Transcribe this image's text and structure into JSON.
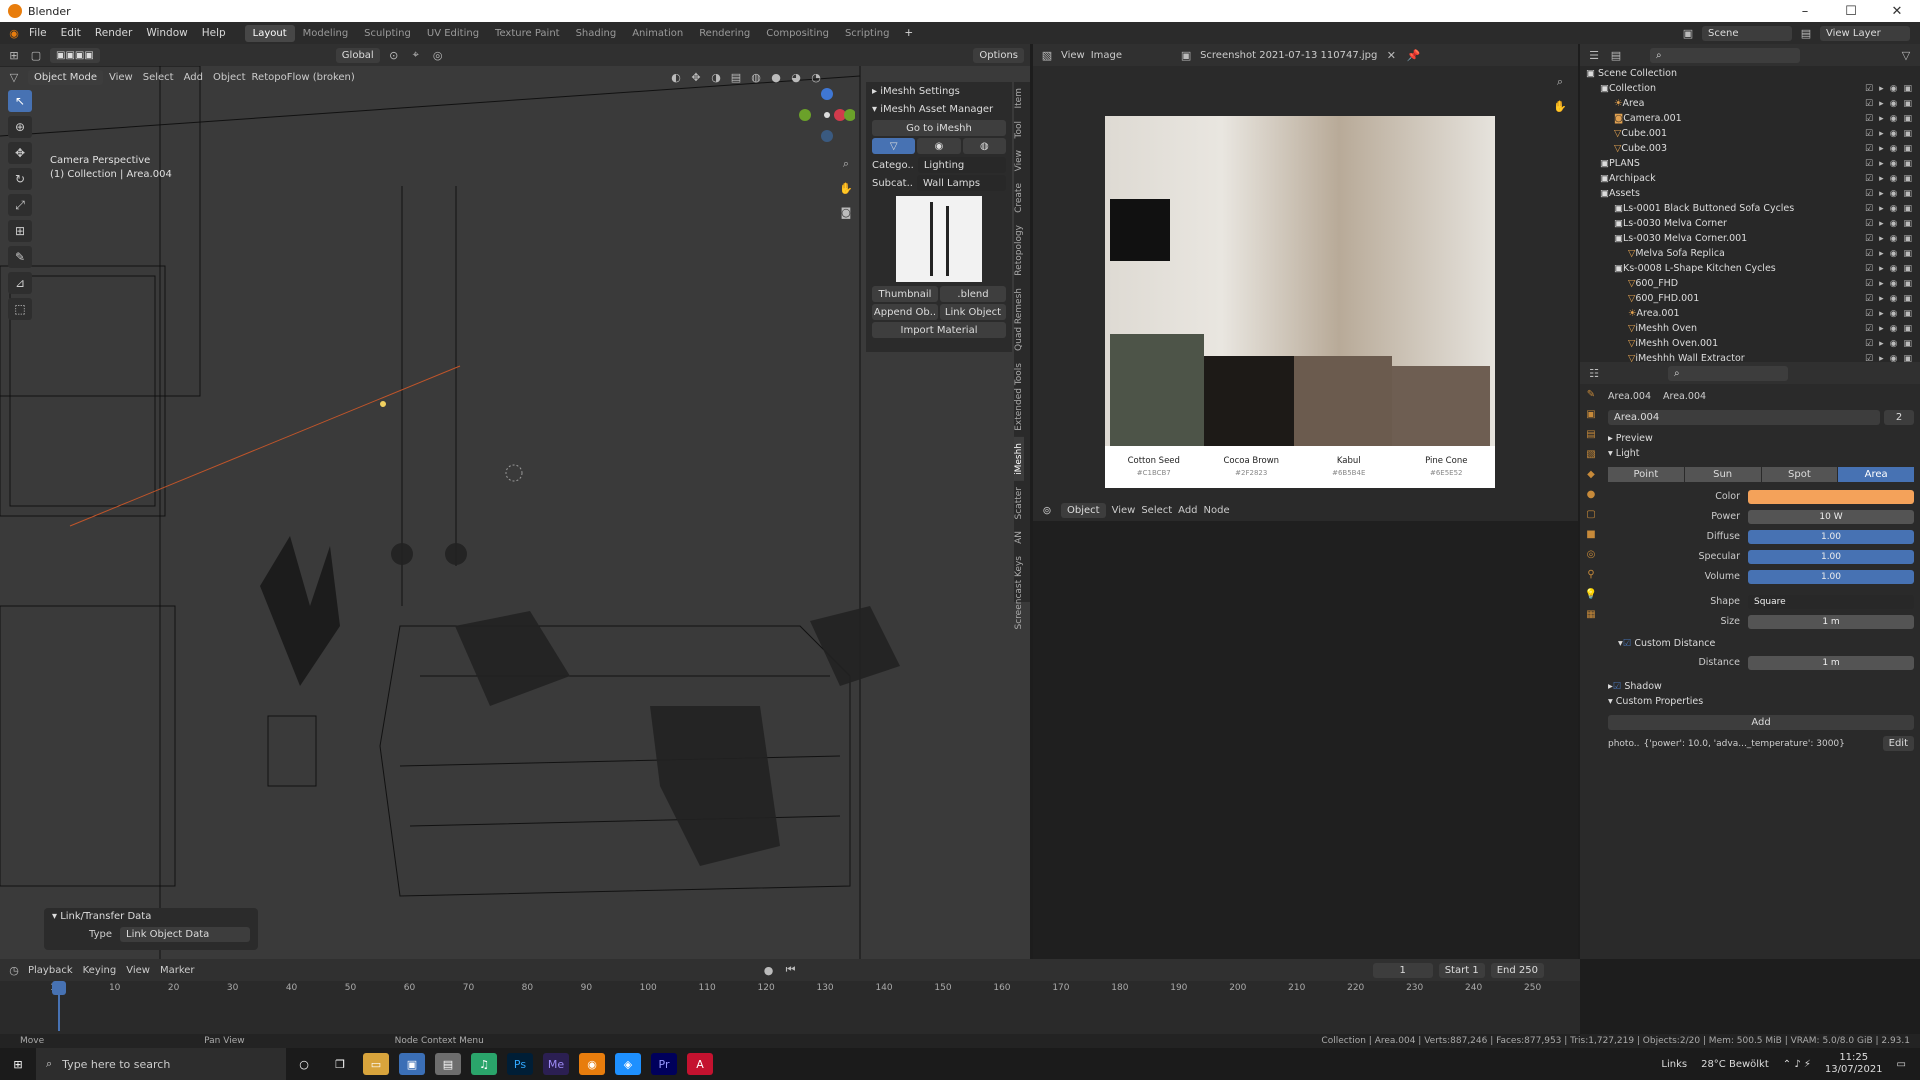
{
  "window": {
    "title": "Blender"
  },
  "menu": {
    "items": [
      "File",
      "Edit",
      "Render",
      "Window",
      "Help"
    ],
    "workspaces": [
      "Layout",
      "Modeling",
      "Sculpting",
      "UV Editing",
      "Texture Paint",
      "Shading",
      "Animation",
      "Rendering",
      "Compositing",
      "Scripting"
    ],
    "active_ws": "Layout",
    "scene": "Scene",
    "view_layer": "View Layer"
  },
  "viewport": {
    "mode": "Object Mode",
    "menus": [
      "View",
      "Select",
      "Add",
      "Object"
    ],
    "addon_menu": "RetopoFlow (broken)",
    "orientation": "Global",
    "options": "Options",
    "overlay_line1": "Camera Perspective",
    "overlay_line2": "(1) Collection | Area.004"
  },
  "npanel": {
    "settings": "iMeshh Settings",
    "manager": "iMeshh Asset Manager",
    "goto": "Go to iMeshh",
    "category_label": "Catego..",
    "category_value": "Lighting",
    "subcat_label": "Subcat..",
    "subcat_value": "Wall Lamps",
    "thumbnail": "Thumbnail",
    "blend": ".blend",
    "append": "Append Ob..",
    "link": "Link Object",
    "import": "Import Material",
    "tabs": [
      "Item",
      "Tool",
      "View",
      "Create",
      "Retopology",
      "Quad Remesh",
      "Extended Tools",
      "iMeshh",
      "Scatter",
      "AN",
      "Screencast Keys"
    ]
  },
  "linkpanel": {
    "title": "Link/Transfer Data",
    "type_label": "Type",
    "type_value": "Link Object Data"
  },
  "image_editor": {
    "menus": [
      "View",
      "Image"
    ],
    "filename": "Screenshot 2021-07-13 110747.jpg",
    "swatches": [
      {
        "name": "Cotton Seed",
        "code": "#C1BCB7",
        "color": "#c1bcb7"
      },
      {
        "name": "Cocoa Brown",
        "code": "#2F2823",
        "color": "#2f2823"
      },
      {
        "name": "Kabul",
        "code": "#6B5B4E",
        "color": "#6b5b4e"
      },
      {
        "name": "Pine Cone",
        "code": "#6E5E52",
        "color": "#6e5e52"
      }
    ]
  },
  "node_editor": {
    "type": "Object",
    "menus": [
      "View",
      "Select",
      "Add",
      "Node"
    ]
  },
  "outliner": {
    "title": "Scene Collection",
    "rows": [
      {
        "label": "Collection",
        "d": 1,
        "i": "box"
      },
      {
        "label": "Area",
        "d": 2,
        "i": "light"
      },
      {
        "label": "Camera.001",
        "d": 2,
        "i": "cam"
      },
      {
        "label": "Cube.001",
        "d": 2,
        "i": "mesh"
      },
      {
        "label": "Cube.003",
        "d": 2,
        "i": "mesh"
      },
      {
        "label": "PLANS",
        "d": 1,
        "i": "box"
      },
      {
        "label": "Archipack",
        "d": 1,
        "i": "box"
      },
      {
        "label": "Assets",
        "d": 1,
        "i": "box"
      },
      {
        "label": "Ls-0001 Black Buttoned Sofa Cycles",
        "d": 2,
        "i": "box"
      },
      {
        "label": "Ls-0030 Melva Corner",
        "d": 2,
        "i": "box"
      },
      {
        "label": "Ls-0030 Melva Corner.001",
        "d": 2,
        "i": "box"
      },
      {
        "label": "Melva Sofa Replica",
        "d": 3,
        "i": "mesh"
      },
      {
        "label": "Ks-0008 L-Shape Kitchen Cycles",
        "d": 2,
        "i": "box"
      },
      {
        "label": "600_FHD",
        "d": 3,
        "i": "mesh"
      },
      {
        "label": "600_FHD.001",
        "d": 3,
        "i": "mesh"
      },
      {
        "label": "Area.001",
        "d": 3,
        "i": "light"
      },
      {
        "label": "iMeshh Oven",
        "d": 3,
        "i": "mesh"
      },
      {
        "label": "iMeshh Oven.001",
        "d": 3,
        "i": "mesh"
      },
      {
        "label": "iMeshhh Wall Extractor",
        "d": 3,
        "i": "mesh"
      }
    ]
  },
  "properties": {
    "obj": "Area.004",
    "data": "Area.004",
    "datablock": "Area.004",
    "users": "2",
    "preview": "Preview",
    "light": "Light",
    "light_types": [
      "Point",
      "Sun",
      "Spot",
      "Area"
    ],
    "active_type": "Area",
    "color_label": "Color",
    "color": "#f4a25a",
    "power_label": "Power",
    "power": "10 W",
    "diffuse_label": "Diffuse",
    "diffuse": "1.00",
    "specular_label": "Specular",
    "specular": "1.00",
    "volume_label": "Volume",
    "volume": "1.00",
    "shape_label": "Shape",
    "shape": "Square",
    "size_label": "Size",
    "size": "1 m",
    "custom_distance": "Custom Distance",
    "distance_label": "Distance",
    "distance": "1 m",
    "shadow": "Shadow",
    "custom_props": "Custom Properties",
    "add": "Add",
    "prop_key": "photo..",
    "prop_val": "{'power': 10.0, 'adva..._temperature': 3000}",
    "edit": "Edit"
  },
  "timeline": {
    "menus": [
      "Playback",
      "Keying",
      "View",
      "Marker"
    ],
    "frame": "1",
    "start_label": "Start",
    "start": "1",
    "end_label": "End",
    "end": "250",
    "ticks": [
      "1",
      "10",
      "20",
      "30",
      "40",
      "50",
      "60",
      "70",
      "80",
      "90",
      "100",
      "110",
      "120",
      "130",
      "140",
      "150",
      "160",
      "170",
      "180",
      "190",
      "200",
      "210",
      "220",
      "230",
      "240",
      "250"
    ]
  },
  "status": {
    "left1": "Move",
    "left2": "Pan View",
    "left3": "Node Context Menu",
    "right": "Collection | Area.004 | Verts:887,246 | Faces:877,953 | Tris:1,727,219 | Objects:2/20 | Mem: 500.5 MiB | VRAM: 5.0/8.0 GiB | 2.93.1"
  },
  "taskbar": {
    "search": "Type here to search",
    "links": "Links",
    "weather": "28°C Bewölkt",
    "time": "11:25",
    "date": "13/07/2021"
  }
}
